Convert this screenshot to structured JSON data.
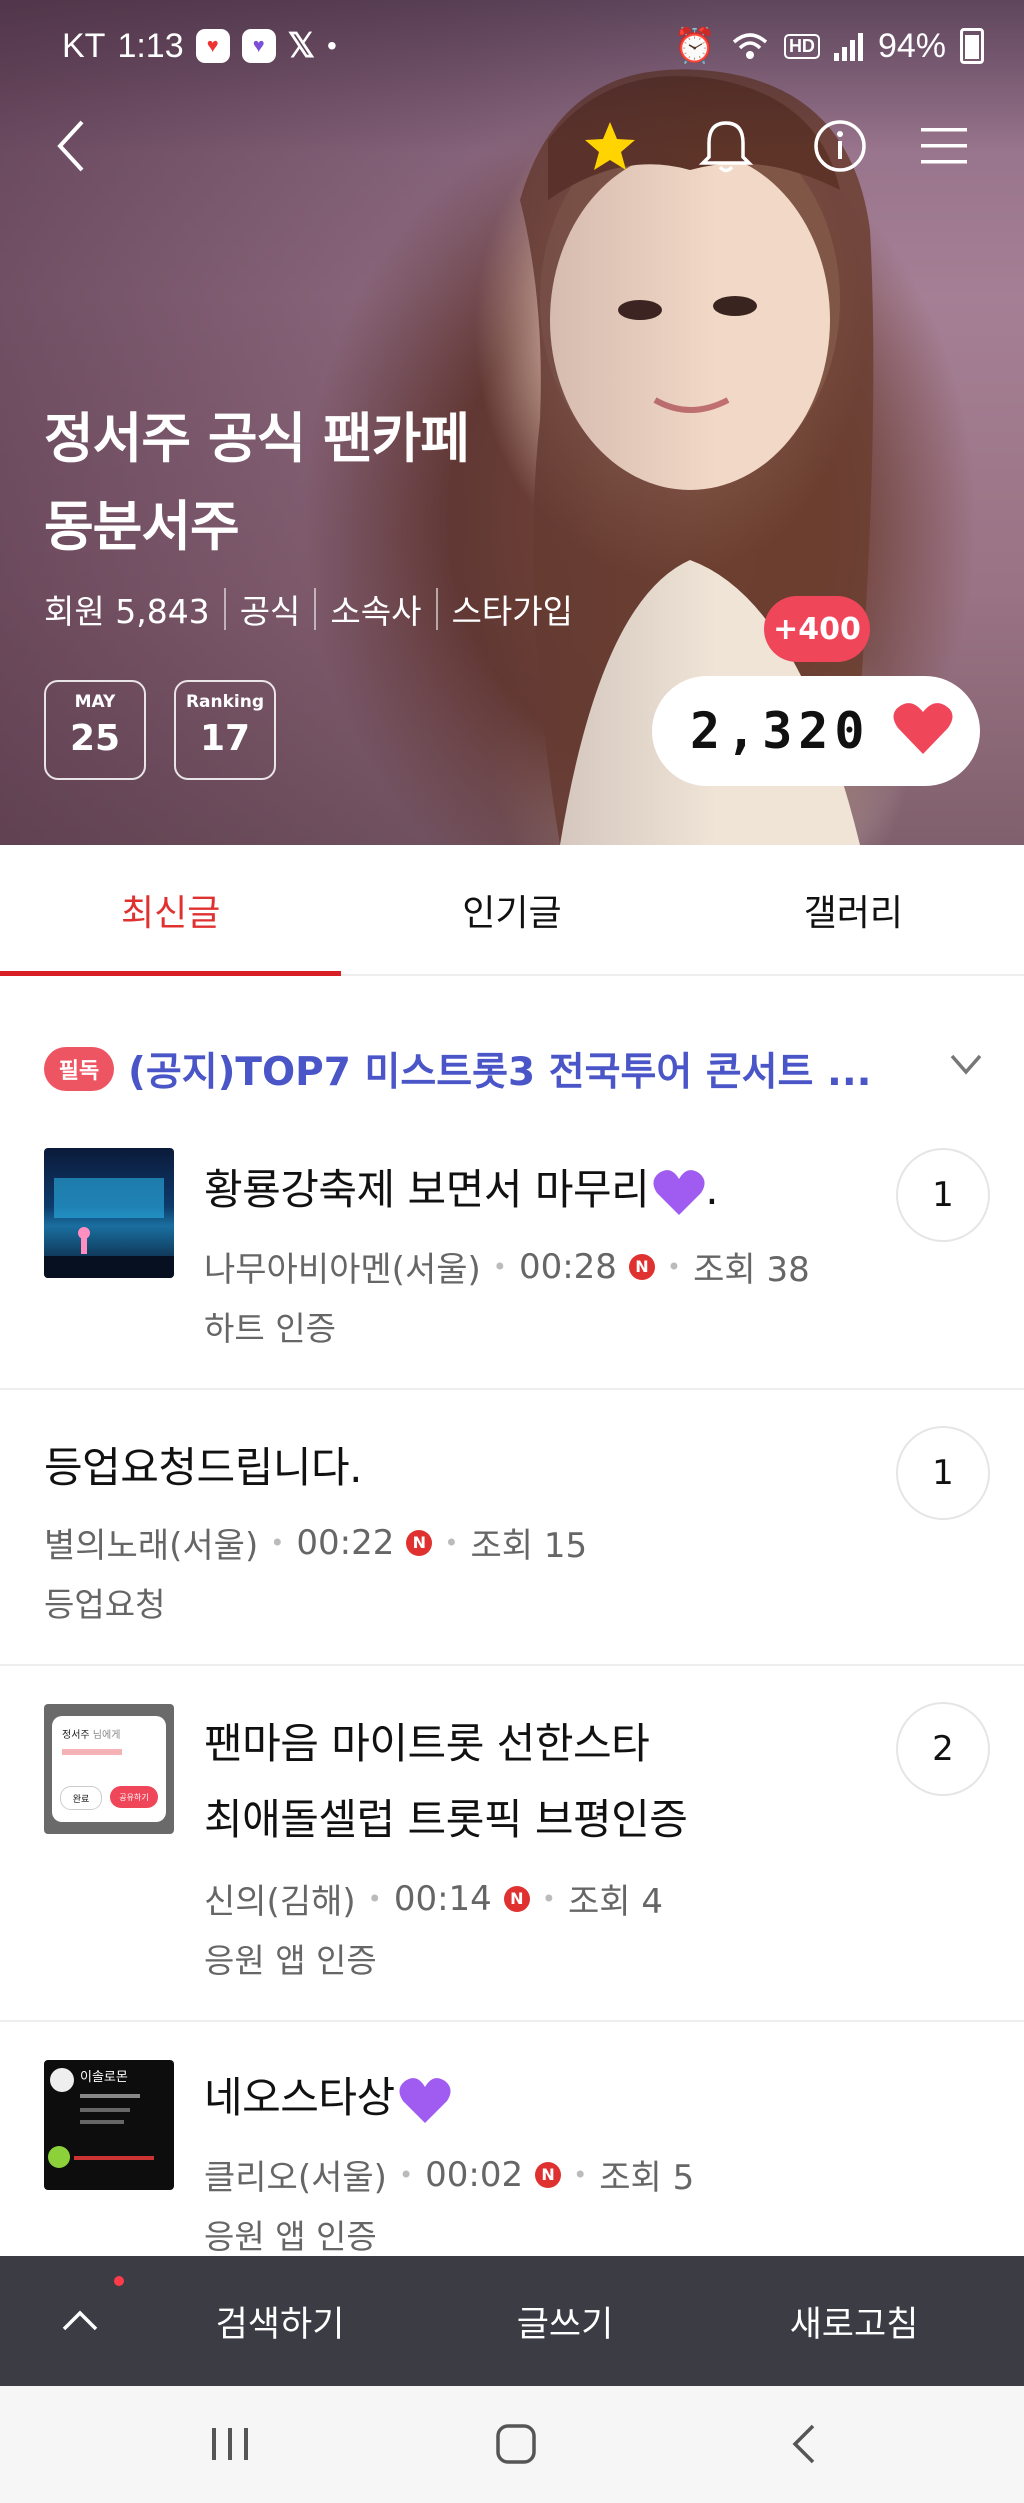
{
  "status_bar": {
    "carrier": "KT",
    "time": "1:13",
    "battery": "94%",
    "hd": "HD"
  },
  "cafe": {
    "title_line1": "정서주 공식 팬카페",
    "title_line2": "동분서주",
    "members": "회원 5,843",
    "official": "공식",
    "agency": "소속사",
    "star_joined": "스타가입",
    "date_month": "MAY",
    "date_day": "25",
    "ranking_label": "Ranking",
    "ranking_value": "17",
    "plus_badge": "+400",
    "like_count": "2,320"
  },
  "tabs": [
    {
      "label": "최신글",
      "active": true
    },
    {
      "label": "인기글",
      "active": false
    },
    {
      "label": "갤러리",
      "active": false
    }
  ],
  "notice": {
    "badge": "필독",
    "text": "(공지)TOP7 미스트롯3 전국투어 콘서트 ..."
  },
  "posts": [
    {
      "title": "황룡강축제 보면서 마무리",
      "title_suffix": ".",
      "author": "나무아비아멘(서울)",
      "time": "00:28",
      "views": "조회 38",
      "tag": "하트 인증",
      "comments": "1"
    },
    {
      "title": "등업요청드립니다.",
      "author": "별의노래(서울)",
      "time": "00:22",
      "views": "조회 15",
      "tag": "등업요청",
      "comments": "1"
    },
    {
      "title_line1": "팬마음 마이트롯 선한스타",
      "title_line2": "최애돌셀럽 트롯픽 브평인증",
      "author": "신의(김해)",
      "time": "00:14",
      "views": "조회 4",
      "tag": "응원 앱 인증",
      "comments": "2",
      "thumb_name": "정서주",
      "thumb_sub": "님에게",
      "thumb_btn1": "완료",
      "thumb_btn2": "공유하기"
    },
    {
      "title": "네오스타상",
      "author": "클리오(서울)",
      "time": "00:02",
      "views": "조회 5",
      "tag": "응원 앱 인증",
      "thumb_name": "이솔로몬"
    }
  ],
  "bottom_bar": {
    "search": "검색하기",
    "write": "글쓰기",
    "refresh": "새로고침"
  },
  "colors": {
    "accent_red": "#e03131",
    "notice_blue": "#4a56c8",
    "bottom_bar_bg": "#3b3c44",
    "heart": "#f0465a"
  }
}
